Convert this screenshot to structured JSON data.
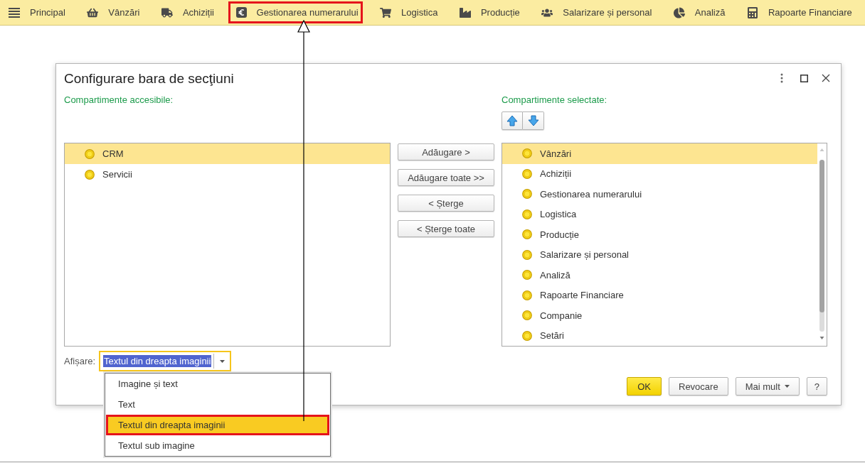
{
  "nav_bar": {
    "items": [
      {
        "label": "Principal",
        "highlighted": false
      },
      {
        "label": "Vânzări",
        "highlighted": false
      },
      {
        "label": "Achiziții",
        "highlighted": false
      },
      {
        "label": "Gestionarea numerarului",
        "highlighted": true
      },
      {
        "label": "Logistica",
        "highlighted": false
      },
      {
        "label": "Producție",
        "highlighted": false
      },
      {
        "label": "Salarizare și personal",
        "highlighted": false
      },
      {
        "label": "Analiză",
        "highlighted": false
      },
      {
        "label": "Rapoarte Financiare",
        "highlighted": false
      }
    ]
  },
  "dialog": {
    "title": "Configurare bara de secţiuni",
    "available": {
      "label": "Compartimente accesibile:",
      "items": [
        {
          "label": "CRM",
          "selected": true
        },
        {
          "label": "Servicii",
          "selected": false
        }
      ]
    },
    "transfer_buttons": [
      "Adăugare >",
      "Adăugare toate >>",
      "< Șterge",
      "< Șterge toate"
    ],
    "chosen": {
      "label": "Compartimente selectate:",
      "items": [
        {
          "label": "Vânzări",
          "selected": true
        },
        {
          "label": "Achiziții",
          "selected": false
        },
        {
          "label": "Gestionarea numerarului",
          "selected": false
        },
        {
          "label": "Logistica",
          "selected": false
        },
        {
          "label": "Producție",
          "selected": false
        },
        {
          "label": "Salarizare și personal",
          "selected": false
        },
        {
          "label": "Analiză",
          "selected": false
        },
        {
          "label": "Rapoarte Financiare",
          "selected": false
        },
        {
          "label": "Companie",
          "selected": false
        },
        {
          "label": "Setări",
          "selected": false
        }
      ]
    },
    "display": {
      "label": "Afișare:",
      "value": "Textul din dreapta imaginii",
      "focused": true,
      "expanded": true,
      "options": [
        {
          "label": "Imagine și text",
          "selected": false,
          "highlighted": false
        },
        {
          "label": "Text",
          "selected": false,
          "highlighted": false
        },
        {
          "label": "Textul din dreapta imaginii",
          "selected": true,
          "highlighted": true
        },
        {
          "label": "Textul sub imagine",
          "selected": false,
          "highlighted": false
        }
      ]
    },
    "buttons": [
      {
        "label": "OK",
        "kind": "primary"
      },
      {
        "label": "Revocare",
        "kind": "plain"
      },
      {
        "label": "Mai mult",
        "kind": "menu"
      },
      {
        "label": "?",
        "kind": "plain"
      }
    ]
  }
}
